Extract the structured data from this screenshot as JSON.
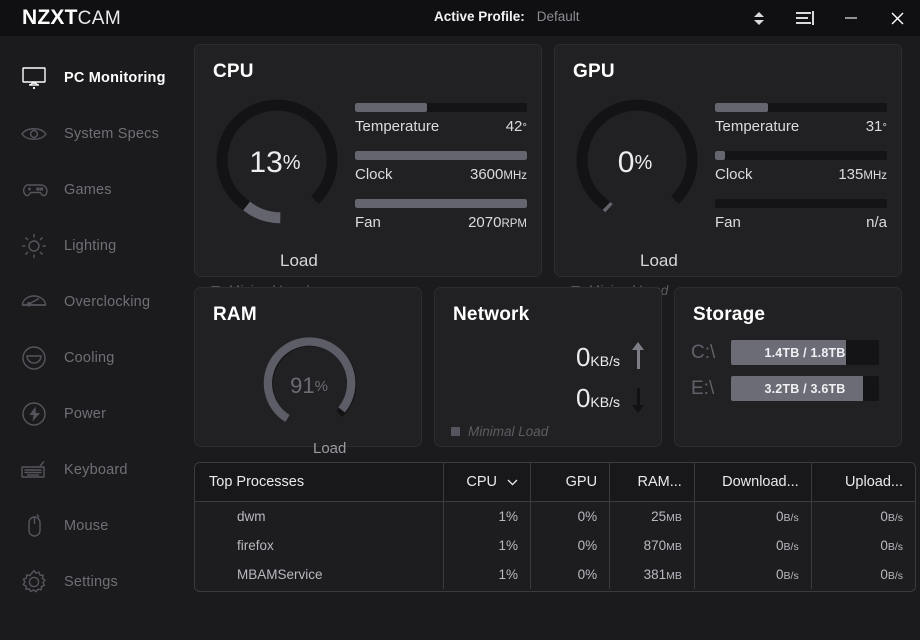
{
  "app": {
    "brand_bold": "NZXT",
    "brand_light": "CAM"
  },
  "header": {
    "profile_label": "Active Profile:",
    "profile_value": "Default",
    "spinner_icon": "updown-chevron-icon",
    "menu_icon": "list-menu-icon",
    "minimize_label": "—",
    "close_label": "✕"
  },
  "sidebar": {
    "items": [
      {
        "label": "PC Monitoring",
        "icon": "monitor-icon",
        "active": true
      },
      {
        "label": "System Specs",
        "icon": "eye-icon",
        "active": false
      },
      {
        "label": "Games",
        "icon": "gamepad-icon",
        "active": false
      },
      {
        "label": "Lighting",
        "icon": "sun-icon",
        "active": false
      },
      {
        "label": "Overclocking",
        "icon": "gauge-icon",
        "active": false
      },
      {
        "label": "Cooling",
        "icon": "fan-dome-icon",
        "active": false
      },
      {
        "label": "Power",
        "icon": "bolt-icon",
        "active": false
      },
      {
        "label": "Keyboard",
        "icon": "keyboard-icon",
        "active": false
      },
      {
        "label": "Mouse",
        "icon": "mouse-icon",
        "active": false
      },
      {
        "label": "Settings",
        "icon": "gear-icon",
        "active": false
      }
    ]
  },
  "cards": {
    "cpu": {
      "title": "CPU",
      "load_percent": 13,
      "load_value": "13",
      "load_sign": "%",
      "load_label": "Load",
      "status": "Minimal Load",
      "stats": [
        {
          "name": "Temperature",
          "value": "42",
          "unit": "°",
          "fill": 42
        },
        {
          "name": "Clock",
          "value": "3600",
          "unit": "MHz",
          "fill": 100
        },
        {
          "name": "Fan",
          "value": "2070",
          "unit": "RPM",
          "fill": 100
        }
      ]
    },
    "gpu": {
      "title": "GPU",
      "load_percent": 0,
      "load_value": "0",
      "load_sign": "%",
      "load_label": "Load",
      "status": "Minimal Load",
      "stats": [
        {
          "name": "Temperature",
          "value": "31",
          "unit": "°",
          "fill": 31
        },
        {
          "name": "Clock",
          "value": "135",
          "unit": "MHz",
          "fill": 6
        },
        {
          "name": "Fan",
          "value": "n/a",
          "unit": "",
          "fill": 0
        }
      ]
    },
    "ram": {
      "title": "RAM",
      "load_percent": 91,
      "load_value": "91",
      "load_sign": "%",
      "load_label": "Load"
    },
    "network": {
      "title": "Network",
      "upload_value": "0",
      "upload_unit": "KB/s",
      "download_value": "0",
      "download_unit": "KB/s",
      "upload_icon": "arrow-up-icon",
      "download_icon": "arrow-down-icon",
      "status": "Minimal Load"
    },
    "storage": {
      "title": "Storage",
      "drives": [
        {
          "label": "C:\\",
          "text": "1.4TB / 1.8TB",
          "fill": 78
        },
        {
          "label": "E:\\",
          "text": "3.2TB / 3.6TB",
          "fill": 89
        }
      ]
    }
  },
  "processes": {
    "columns": [
      "Top Processes",
      "CPU",
      "GPU",
      "RAM...",
      "Download...",
      "Upload..."
    ],
    "sorted_column": "CPU",
    "sort_icon": "chevron-down-icon",
    "rows": [
      {
        "name": "dwm",
        "cpu": "1%",
        "gpu": "0%",
        "ram": "25",
        "ram_unit": "MB",
        "download": "0",
        "download_unit": "B/s",
        "upload": "0",
        "upload_unit": "B/s"
      },
      {
        "name": "firefox",
        "cpu": "1%",
        "gpu": "0%",
        "ram": "870",
        "ram_unit": "MB",
        "download": "0",
        "download_unit": "B/s",
        "upload": "0",
        "upload_unit": "B/s"
      },
      {
        "name": "MBAMService",
        "cpu": "1%",
        "gpu": "0%",
        "ram": "381",
        "ram_unit": "MB",
        "download": "0",
        "download_unit": "B/s",
        "upload": "0",
        "upload_unit": "B/s"
      }
    ]
  },
  "colors": {
    "page_bg": "#1b1b1d",
    "titlebar_bg": "#101012",
    "card_bg": "#212124",
    "accent_gray": "#65656f",
    "track_dark": "#141416",
    "text_primary": "#ededf0",
    "text_muted": "#6f6f77"
  }
}
